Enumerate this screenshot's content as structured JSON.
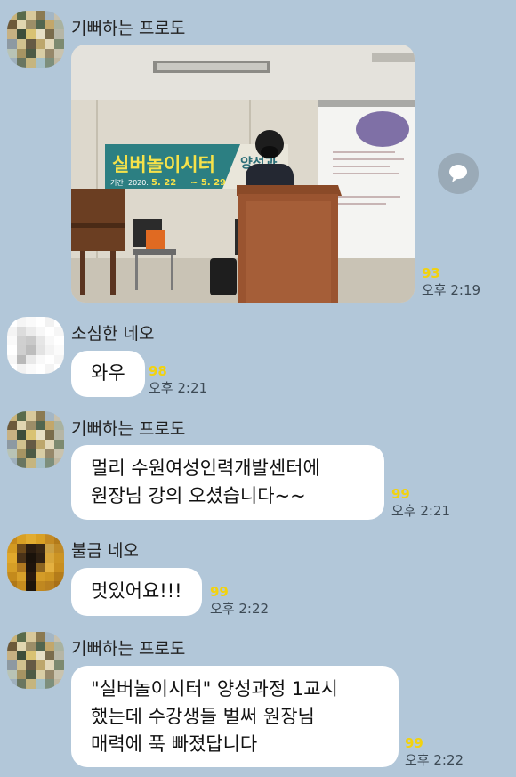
{
  "messages": [
    {
      "sender": "기뻐하는 프로도",
      "type": "photo",
      "unread": "93",
      "time": "오후 2:19"
    },
    {
      "sender": "소심한 네오",
      "text": "와우",
      "unread": "98",
      "time": "오후 2:21"
    },
    {
      "sender": "기뻐하는 프로도",
      "lines": [
        "멀리 수원여성인력개발센터에",
        "원장님 강의 오셨습니다~~"
      ],
      "unread": "99",
      "time": "오후 2:21"
    },
    {
      "sender": "불금 네오",
      "text": "멋있어요!!!",
      "unread": "99",
      "time": "오후 2:22"
    },
    {
      "sender": "기뻐하는 프로도",
      "lines": [
        "\"실버놀이시터\" 양성과정 1교시",
        "했는데 수강생들 벌써 원장님",
        "매력에 푹 빠졌답니다"
      ],
      "unread": "99",
      "time": "오후 2:22"
    }
  ],
  "photo": {
    "banner_title": "실버놀이시터",
    "banner_subtitle": "양성과",
    "banner_period_label": "기간",
    "banner_year": "2020.",
    "banner_start": "5. 22",
    "banner_end": "~ 5. 29"
  },
  "share_icon": "speech-bubble-icon",
  "colors": {
    "background": "#b2c7d9",
    "bubble": "#ffffff",
    "unread": "#f2d20e",
    "time": "#3d4a55"
  }
}
